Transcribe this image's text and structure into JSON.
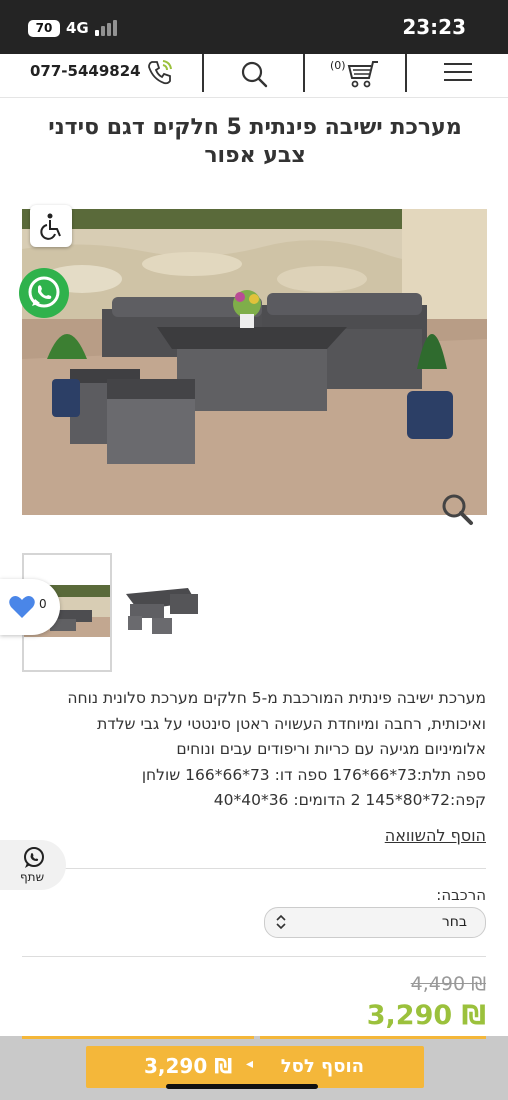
{
  "status_bar": {
    "battery": "70",
    "network": "4G",
    "time": "23:23"
  },
  "header": {
    "phone": "077-5449824",
    "cart_count": "(0)",
    "icons": [
      "phone-icon",
      "search-icon",
      "cart-icon",
      "menu-icon"
    ]
  },
  "product": {
    "title": "מערכת ישיבה פינתית 5 חלקים דגם סידני צבע אפור",
    "description": [
      "מערכת ישיבה פינתית המורכבת מ-5 חלקים מערכת סלונית נוחה",
      "ואיכותית, רחבה ומיוחדת העשויה ראטן סינטטי על גבי שלדת",
      "אלומיניום מגיעה עם כריות וריפודים עבים ונוחים",
      "ספה תלת:73*66*176 ספה דו: 73*66*166 שולחן",
      "קפה:72*80*145 2 הדומים: 36*40*40"
    ],
    "compare_link": "הוסף להשוואה",
    "wishlist_count": "0",
    "share_label": "שתף",
    "composition_label": "הרכבה:",
    "composition_selected": "בחר",
    "old_price": "4,490 ₪",
    "price": "3,290 ₪"
  },
  "bottom_bar": {
    "add_to_cart_label": "הוסף לסל",
    "price": "3,290 ₪",
    "arrow": "◂"
  },
  "colors": {
    "accent": "#f4b73a",
    "price_green": "#9bc13c",
    "status_bar": "#242424"
  }
}
